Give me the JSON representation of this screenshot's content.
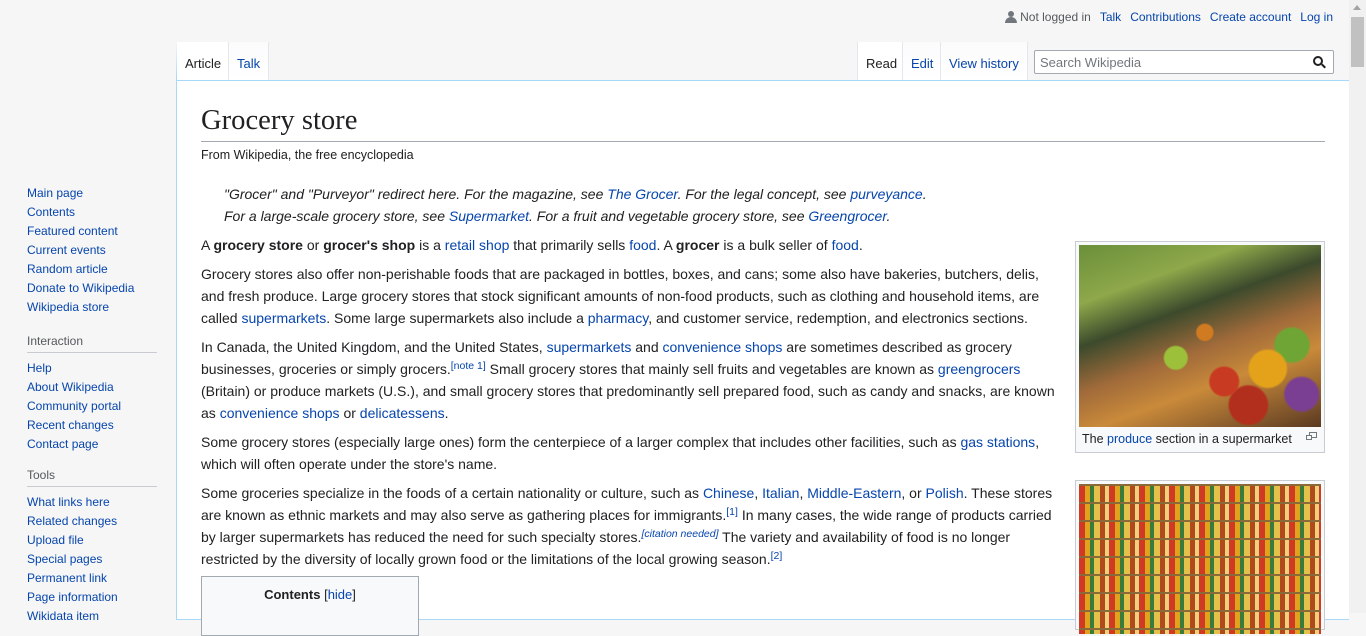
{
  "personal": {
    "anon_text": "Not logged in",
    "links": [
      "Talk",
      "Contributions",
      "Create account",
      "Log in"
    ]
  },
  "tabs": {
    "namespaces": [
      "Article",
      "Talk"
    ],
    "views": [
      "Read",
      "Edit",
      "View history"
    ],
    "selected_namespace": "Article",
    "selected_view": "Read"
  },
  "search": {
    "placeholder": "Search Wikipedia"
  },
  "sidebar": {
    "navigation": [
      "Main page",
      "Contents",
      "Featured content",
      "Current events",
      "Random article",
      "Donate to Wikipedia",
      "Wikipedia store"
    ],
    "interaction": {
      "heading": "Interaction",
      "items": [
        "Help",
        "About Wikipedia",
        "Community portal",
        "Recent changes",
        "Contact page"
      ]
    },
    "tools": {
      "heading": "Tools",
      "items": [
        "What links here",
        "Related changes",
        "Upload file",
        "Special pages",
        "Permanent link",
        "Page information",
        "Wikidata item"
      ]
    }
  },
  "article": {
    "title": "Grocery store",
    "tagline": "From Wikipedia, the free encyclopedia",
    "hatnotes": {
      "line1": {
        "t1": "\"Grocer\" and \"Purveyor\" redirect here. For the magazine, see ",
        "l1": "The Grocer",
        "t2": ". For the legal concept, see ",
        "l2": "purveyance",
        "t3": "."
      },
      "line2": {
        "t1": "For a large-scale grocery store, see ",
        "l1": "Supermarket",
        "t2": ". For a fruit and vegetable grocery store, see ",
        "l2": "Greengrocer",
        "t3": "."
      }
    },
    "p1": {
      "t1": "A ",
      "b1": "grocery store",
      "t2": " or ",
      "b2": "grocer's shop",
      "t3": " is a ",
      "l1": "retail shop",
      "t4": " that primarily sells ",
      "l2": "food",
      "t5": ". A ",
      "b3": "grocer",
      "t6": " is a bulk seller of ",
      "l3": "food",
      "t7": "."
    },
    "p2": {
      "t1": "Grocery stores also offer non-perishable foods that are packaged in bottles, boxes, and cans; some also have bakeries, butchers, delis, and fresh produce. Large grocery stores that stock significant amounts of non-food products, such as clothing and household items, are called ",
      "l1": "supermarkets",
      "t2": ". Some large supermarkets also include a ",
      "l2": "pharmacy",
      "t3": ", and customer service, redemption, and electronics sections."
    },
    "p3": {
      "t1": "In Canada, the United Kingdom, and the United States, ",
      "l1": "supermarkets",
      "t2": " and ",
      "l2": "convenience shops",
      "t3": " are sometimes described as grocery businesses, groceries or simply grocers.",
      "sup1": "[note 1]",
      "t4": " Small grocery stores that mainly sell fruits and vegetables are known as ",
      "l3": "greengrocers",
      "t5": " (Britain) or produce markets (U.S.), and small grocery stores that predominantly sell prepared food, such as candy and snacks, are known as ",
      "l4": "convenience shops",
      "t6": " or ",
      "l5": "delicatessens",
      "t7": "."
    },
    "p4": {
      "t1": "Some grocery stores (especially large ones) form the centerpiece of a larger complex that includes other facilities, such as ",
      "l1": "gas stations",
      "t2": ", which will often operate under the store's name."
    },
    "p5": {
      "t1": "Some groceries specialize in the foods of a certain nationality or culture, such as ",
      "l1": "Chinese",
      "t2": ", ",
      "l2": "Italian",
      "t3": ", ",
      "l3": "Middle-Eastern",
      "t4": ", or ",
      "l4": "Polish",
      "t5": ". These stores are known as ethnic markets and may also serve as gathering places for immigrants.",
      "sup1": "[1]",
      "t6": " In many cases, the wide range of products carried by larger supermarkets has reduced the need for such specialty stores.",
      "sup2": "[citation needed]",
      "t7": " The variety and availability of food is no longer restricted by the diversity of locally grown food or the limitations of the local growing season.",
      "sup3": "[2]"
    },
    "thumb1": {
      "t1": "The ",
      "l1": "produce",
      "t2": " section in a supermarket"
    },
    "toc": {
      "title": "Contents",
      "lb": "[",
      "toggle": "hide",
      "rb": "]"
    }
  },
  "colors": {
    "link": "#0645ad",
    "border_blue": "#a7d7f9",
    "text": "#202122"
  }
}
